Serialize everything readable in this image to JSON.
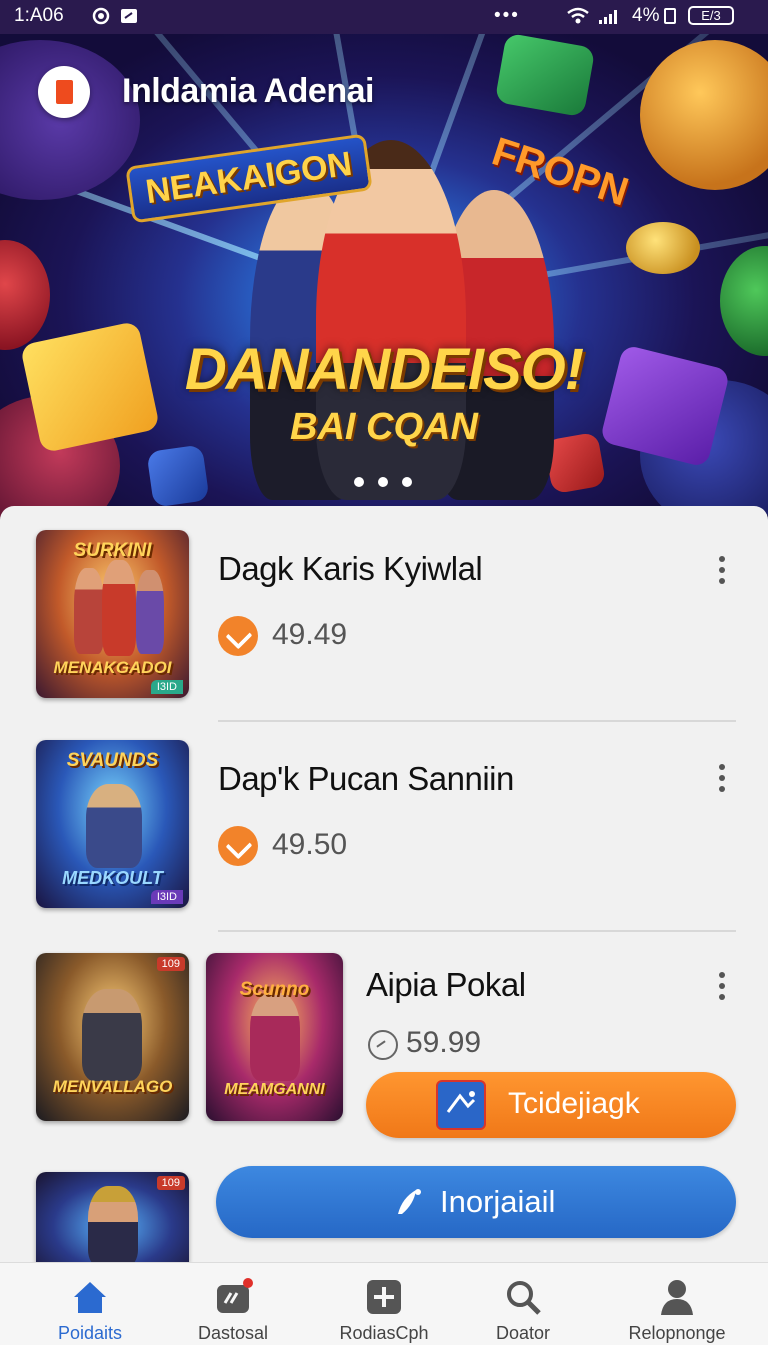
{
  "status_bar": {
    "time": "1:A06",
    "dots": "•••",
    "signal_text": "4%",
    "battery": "E/3"
  },
  "app": {
    "title": "Inldamia Adenai"
  },
  "hero": {
    "badge_text": "NEAKAIGON",
    "side_text": "FROPN",
    "headline": "DANANDEISO!",
    "subheadline": "BAI CQAN",
    "carousel_dots": 3
  },
  "items": [
    {
      "title": "Dagk Karis Kyiwlal",
      "price": "49.49",
      "thumb_top_text": "SURKINI",
      "thumb_bottom_text": "MENAKGADOI",
      "thumb_corner": "I3ID"
    },
    {
      "title": "Dap'k Pucan Sanniin",
      "price": "49.50",
      "thumb_top_text": "SVAUNDS",
      "thumb_bottom_text": "MEDKOULT",
      "thumb_corner": "I3ID"
    },
    {
      "title": "Aipia Pokal",
      "price": "59.99",
      "thumb1_bottom_text": "MENVALLAGO",
      "thumb1_corner": "109",
      "thumb2_top_text": "Scunno",
      "thumb2_bottom_text": "MEAMGANNI",
      "button_label": "Tcidejiagk"
    }
  ],
  "partial_item": {
    "thumb_corner": "109"
  },
  "install_button": {
    "label": "Inorjaiail"
  },
  "bottom_nav": [
    {
      "label": "Poidaits",
      "icon": "home-icon",
      "active": true
    },
    {
      "label": "Dastosal",
      "icon": "gamepad-icon",
      "active": false
    },
    {
      "label": "RodiasCph",
      "icon": "plus-box-icon",
      "active": false
    },
    {
      "label": "Doator",
      "icon": "search-icon",
      "active": false
    },
    {
      "label": "Relopnonge",
      "icon": "profile-icon",
      "active": false
    }
  ],
  "colors": {
    "accent_orange": "#f2832a",
    "accent_blue": "#2b6ad0",
    "status_bar": "#2a1a4e"
  }
}
